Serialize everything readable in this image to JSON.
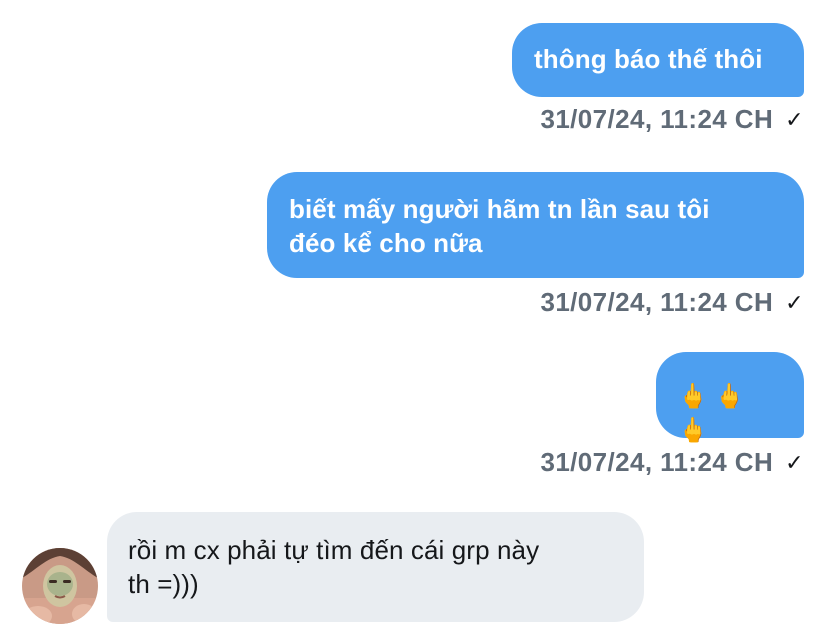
{
  "messages": [
    {
      "id": "m1",
      "direction": "sent",
      "text": "thông báo thế thôi",
      "timestamp": "31/07/24, 11:24 CH",
      "status_icon": "check-icon",
      "status_glyph": "✓"
    },
    {
      "id": "m2",
      "direction": "sent",
      "text": "biết mấy người hãm tn lần sau tôi\nđéo kể cho nữa",
      "timestamp": "31/07/24, 11:24 CH",
      "status_icon": "check-icon",
      "status_glyph": "✓"
    },
    {
      "id": "m3",
      "direction": "sent",
      "text": "🖕🖕🖕",
      "timestamp": "31/07/24, 11:24 CH",
      "status_icon": "check-icon",
      "status_glyph": "✓"
    },
    {
      "id": "m4",
      "direction": "received",
      "text": "rồi m cx phải tự tìm đến cái grp này\nth =)))"
    }
  ],
  "colors": {
    "sent_bubble": "#4d9ff0",
    "received_bubble": "#e9edf1",
    "timestamp": "#606b77"
  }
}
